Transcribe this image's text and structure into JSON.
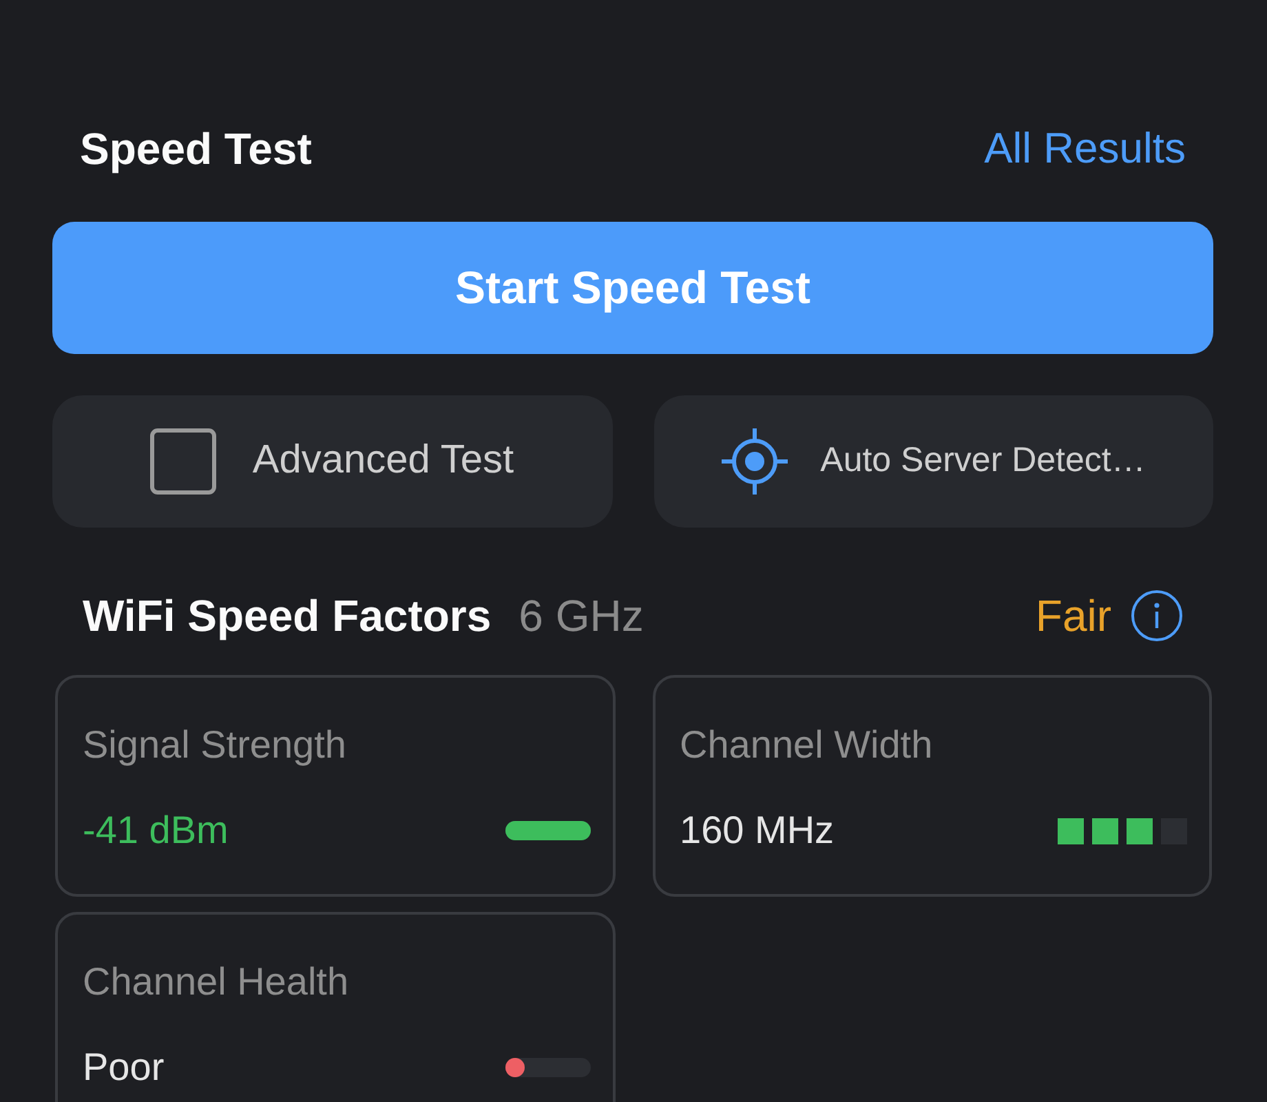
{
  "header": {
    "title": "Speed Test",
    "link": "All Results"
  },
  "start_button": {
    "label": "Start Speed Test"
  },
  "options": [
    {
      "kind": "checkbox",
      "label": "Advanced Test",
      "checked": false
    },
    {
      "kind": "target",
      "label": "Auto Server Detect…"
    }
  ],
  "factors_header": {
    "title": "WiFi Speed Factors",
    "band": "6 GHz",
    "rating": "Fair"
  },
  "factors": [
    {
      "label": "Signal Strength",
      "value": "-41 dBm",
      "kind": "bar",
      "level": 1,
      "color": "#3dbd5c",
      "value_tinted": true
    },
    {
      "label": "Channel Width",
      "value": "160 MHz",
      "kind": "segments",
      "level": 0.75,
      "color": "#3dbd5c",
      "value_tinted": false
    },
    {
      "label": "Channel Health",
      "value": "Poor",
      "kind": "bar",
      "level": 0.2,
      "color": "#ee5f64",
      "value_tinted": false
    }
  ]
}
